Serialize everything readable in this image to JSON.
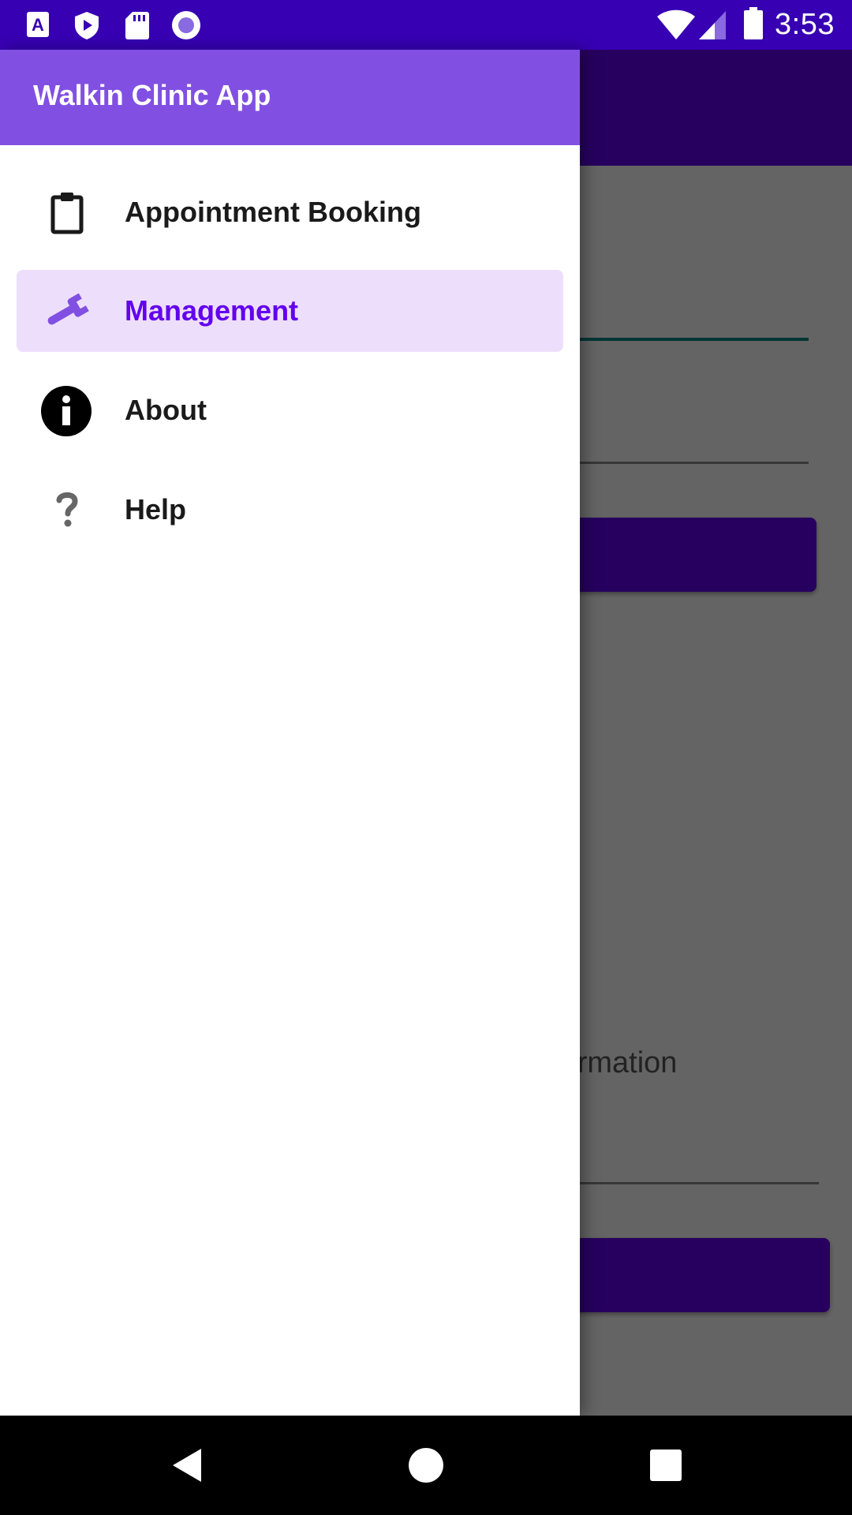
{
  "status_bar": {
    "time": "3:53",
    "left_icons": [
      "text-a-icon",
      "shield-play-icon",
      "sd-card-icon",
      "record-circle-icon"
    ],
    "right_icons": [
      "wifi-icon",
      "cellular-signal-icon",
      "battery-icon"
    ]
  },
  "drawer": {
    "title": "Walkin Clinic App",
    "items": [
      {
        "label": "Appointment Booking",
        "icon": "clipboard-icon",
        "selected": false
      },
      {
        "label": "Management",
        "icon": "wrench-icon",
        "selected": true
      },
      {
        "label": "About",
        "icon": "info-icon",
        "selected": false
      },
      {
        "label": "Help",
        "icon": "help-question-icon",
        "selected": false
      }
    ]
  },
  "background": {
    "hint_text": "formation"
  },
  "colors": {
    "status_bar": "#3700b3",
    "primary": "#6200ee",
    "drawer_header": "#8150e2",
    "selected_item_bg": "#eddffc",
    "selected_item_text": "#6200ee",
    "accent_line": "#018786"
  },
  "navigation_bar": {
    "buttons": [
      "back-icon",
      "home-icon",
      "recents-icon"
    ]
  }
}
